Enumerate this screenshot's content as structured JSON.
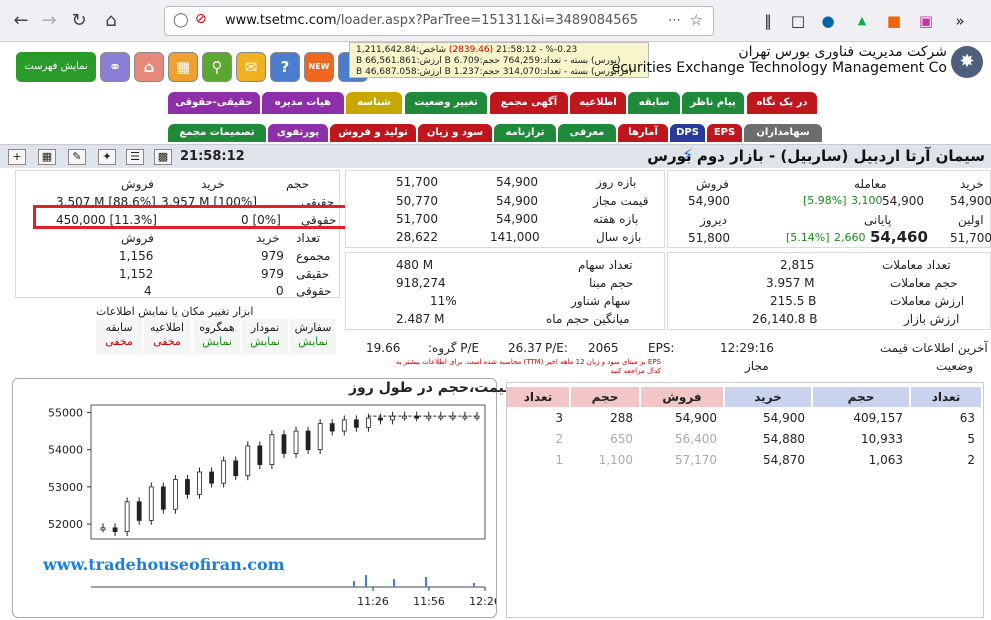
{
  "browser": {
    "url_host": "www.tsetmc.com",
    "url_path": "/loader.aspx?ParTree=151311&i=3489084565"
  },
  "header": {
    "menu_label": "نمایش فهرست",
    "company_fa": "شرکت مدیریت فناوری بورس تهران",
    "company_en": "ecurities Exchange Technology Management Co",
    "ticker": {
      "line1_a": "شاخص:1,211,642.84",
      "line1_b": "(2839.46)",
      "line1_c": "0.23-% - 21:58:12",
      "line2": "(بورس) بسته - تعداد:764,259 حجم:6.709 B ارزش:66,561.861 B",
      "line3": "(فرابورس) بسته - تعداد:314,070 حجم:1.237 B ارزش:46,687.058 B"
    }
  },
  "tabs": {
    "row1": [
      "در یک نگاه",
      "پیام ناظر",
      "سابقه",
      "اطلاعیه",
      "آگهی مجمع",
      "تغییر وضعیت",
      "شناسه",
      "هیات مدیره",
      "حقیقی-حقوقی"
    ],
    "row2": [
      "سهامداران",
      "EPS",
      "DPS",
      "آمارها",
      "معرفی",
      "ترازنامه",
      "سود و زیان",
      "تولید و فروش",
      "پورتفوی",
      "تصمیمات مجمع"
    ]
  },
  "titlebar": {
    "title": "سیمان آرتا اردبیل (ساربیل) - بازار دوم بورس",
    "clock": "21:58:12"
  },
  "hh": {
    "h_buy": "خرید",
    "h_sell": "فروش",
    "h_vol": "حجم",
    "r1_label": "حقیقی",
    "r1_buy": "3.957 M [100%]",
    "r1_sell": "3.507 M [88.6%]",
    "r2_label": "حقوقی",
    "r2_buy": "0 [0%]",
    "r2_sell": "450,000 [11.3%]",
    "h2_count": "تعداد",
    "h2_buy": "خرید",
    "h2_sell": "فروش",
    "c1_label": "مجموع",
    "c1_buy": "979",
    "c1_sell": "1,156",
    "c2_label": "حقیقی",
    "c2_buy": "979",
    "c2_sell": "1,152",
    "c3_label": "حقوقی",
    "c3_buy": "0",
    "c3_sell": "4"
  },
  "ranges": {
    "r1_label": "بازه روز",
    "r1_a": "51,700",
    "r1_b": "54,900",
    "r2_label": "قیمت مجاز",
    "r2_a": "50,770",
    "r2_b": "54,900",
    "r3_label": "بازه هفته",
    "r3_a": "51,700",
    "r3_b": "54,900",
    "r4_label": "بازه سال",
    "r4_a": "28,622",
    "r4_b": "141,000"
  },
  "price": {
    "h_buy": "خرید",
    "h_trade": "معامله",
    "h_sell": "فروش",
    "buy": "54,900",
    "trade_pct": "[5.98%]",
    "trade_chg": "3,100",
    "trade": "54,900",
    "sell": "54,900",
    "first_label": "اولین",
    "close_label": "پایانی",
    "yesterday_label": "دیروز",
    "first": "51,700",
    "close_pct": "[5.14%]",
    "close_chg": "2,660",
    "close": "54,460",
    "yesterday": "51,800"
  },
  "stats": {
    "s1_label": "تعداد معاملات",
    "s1_val": "2,815",
    "s2_label": "حجم معاملات",
    "s2_val": "3.957 M",
    "s3_label": "ارزش معاملات",
    "s3_val": "215.5 B",
    "s4_label": "ارزش بازار",
    "s4_val": "26,140.8 B",
    "t1_label": "تعداد سهام",
    "t1_val": "480 M",
    "t2_label": "حجم مبنا",
    "t2_val": "918,274",
    "t3_label": "سهام شناور",
    "t3_val": "11%",
    "t4_label": "میانگین حجم ماه",
    "t4_val": "2.487 M"
  },
  "info": {
    "last_label": "آخرین اطلاعات قیمت",
    "last_val": "12:29:16",
    "status_label": "وضعیت",
    "status_val": "مجاز",
    "eps_label": "EPS:",
    "eps_val": "2065",
    "pe_label": "P/E:",
    "pe_val": "26.37",
    "gpe_label": "P/E گروه:",
    "gpe_val": "19.66",
    "footnote1": "EPS بر مبنای سود و زیان 12 ماهه اخیر (TTM) محاسبه شده است. برای اطلاعات بیشتر به",
    "footnote2": "کدال مراجعه کنید"
  },
  "tools": {
    "title": "ابزار تغییر مکان یا نمایش اطلاعات",
    "b1": "سفارش",
    "b1s": "نمایش",
    "b2": "نمودار",
    "b2s": "نمایش",
    "b3": "همگروه",
    "b3s": "نمایش",
    "b4": "اطلاعیه",
    "b4s": "مخفی",
    "b5": "سابقه",
    "b5s": "مخفی"
  },
  "orderbook": {
    "headers": [
      "تعداد",
      "حجم",
      "خرید",
      "فروش",
      "حجم",
      "تعداد"
    ],
    "rows": [
      {
        "bc": "63",
        "bv": "409,157",
        "bp": "54,900",
        "sp": "54,900",
        "sv": "288",
        "sc": "3"
      },
      {
        "bc": "5",
        "bv": "10,933",
        "bp": "54,880",
        "sp": "56,400",
        "sv": "650",
        "sc": "2"
      },
      {
        "bc": "2",
        "bv": "1,063",
        "bp": "54,870",
        "sp": "57,170",
        "sv": "1,100",
        "sc": "1"
      }
    ]
  },
  "chart_data": {
    "type": "line",
    "title": "قیمت،حجم در طول روز",
    "xlabel": "",
    "ylabel": "",
    "ylim": [
      51600,
      55200
    ],
    "y_ticks": [
      55000,
      54000,
      53000,
      52000
    ],
    "x_ticks": [
      "11:26",
      "11:56",
      "12:26"
    ],
    "series": [
      {
        "values": [
          51900,
          51800,
          52600,
          52100,
          53000,
          52400,
          53200,
          52800,
          53400,
          53100,
          53700,
          53300,
          54100,
          53600,
          54400,
          53900,
          54500,
          54000,
          54700,
          54500,
          54800,
          54600,
          54850,
          54800,
          54900,
          54900,
          54880,
          54900,
          54900,
          54900,
          54900,
          54900
        ]
      }
    ]
  },
  "watermark": "www.tradehouseofiran.com",
  "colors": {
    "tab_red": "#c0161e",
    "tab_green": "#1f8a3a",
    "tab_purple": "#8e2ea8",
    "tab_yellow": "#c8a800",
    "tab_gray": "#6d6d6d",
    "accent": "#e0202a"
  }
}
